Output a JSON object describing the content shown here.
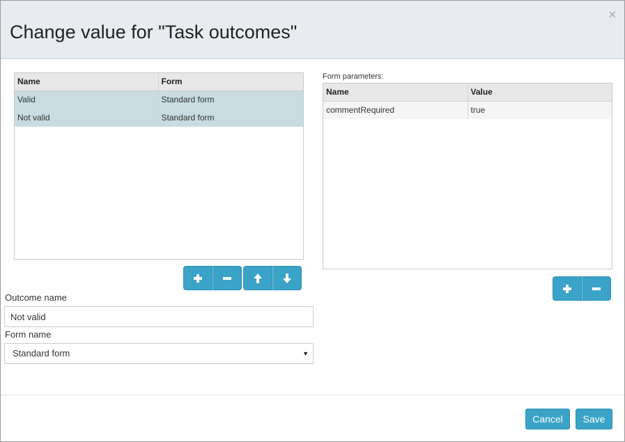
{
  "dialog": {
    "title": "Change value for \"Task outcomes\"",
    "close_glyph": "×"
  },
  "outcomes": {
    "columns": [
      "Name",
      "Form"
    ],
    "rows": [
      {
        "name": "Valid",
        "form": "Standard form"
      },
      {
        "name": "Not valid",
        "form": "Standard form"
      }
    ]
  },
  "params": {
    "label": "Form parameters:",
    "columns": [
      "Name",
      "Value"
    ],
    "rows": [
      {
        "name": "commentRequired",
        "value": "true"
      }
    ]
  },
  "fields": {
    "outcome_name_label": "Outcome name",
    "outcome_name_value": "Not valid",
    "form_name_label": "Form name",
    "form_name_value": "Standard form"
  },
  "icons": {
    "add": "plus-icon",
    "remove": "minus-icon",
    "up": "arrow-up-icon",
    "down": "arrow-down-icon"
  },
  "footer": {
    "cancel_label": "Cancel",
    "save_label": "Save"
  },
  "colors": {
    "accent": "#3aa3c7",
    "selected_row": "#c8dce1",
    "header_bg": "#e8ecf0"
  }
}
